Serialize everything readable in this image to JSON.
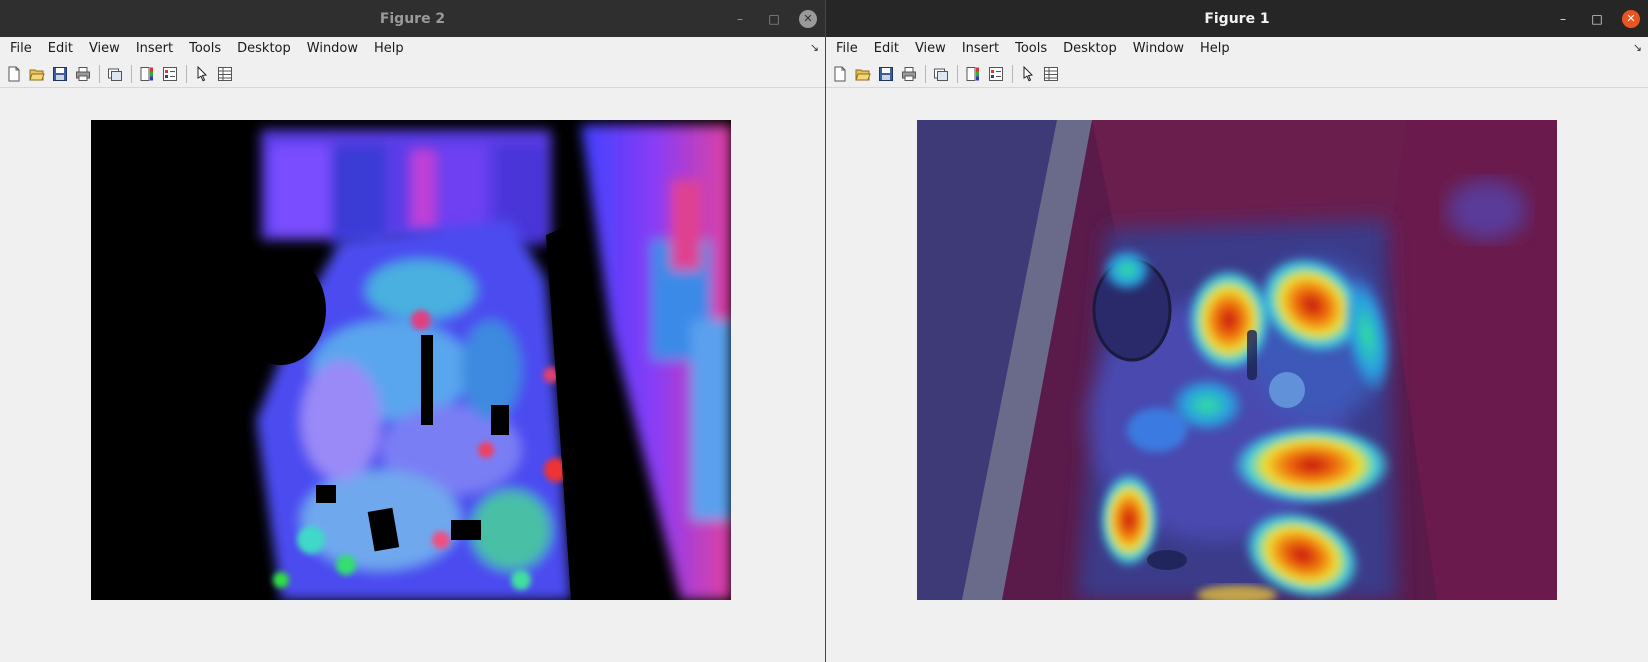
{
  "windows": {
    "left": {
      "title": "Figure 2",
      "menu": [
        "File",
        "Edit",
        "View",
        "Insert",
        "Tools",
        "Desktop",
        "Window",
        "Help"
      ],
      "controls": {
        "minimize": "–",
        "maximize": "□",
        "close": "✕"
      }
    },
    "right": {
      "title": "Figure 1",
      "menu": [
        "File",
        "Edit",
        "View",
        "Insert",
        "Tools",
        "Desktop",
        "Window",
        "Help"
      ],
      "controls": {
        "minimize": "–",
        "maximize": "□",
        "close": "✕"
      }
    }
  },
  "toolbar_icons": [
    "new-figure-icon",
    "open-file-icon",
    "save-icon",
    "print-icon",
    "link-plot-icon",
    "colorbar-icon",
    "legend-icon",
    "edit-plot-icon",
    "property-inspector-icon"
  ],
  "colors": {
    "accent_close_active": "#e95420",
    "background": "#f0f0f0"
  }
}
